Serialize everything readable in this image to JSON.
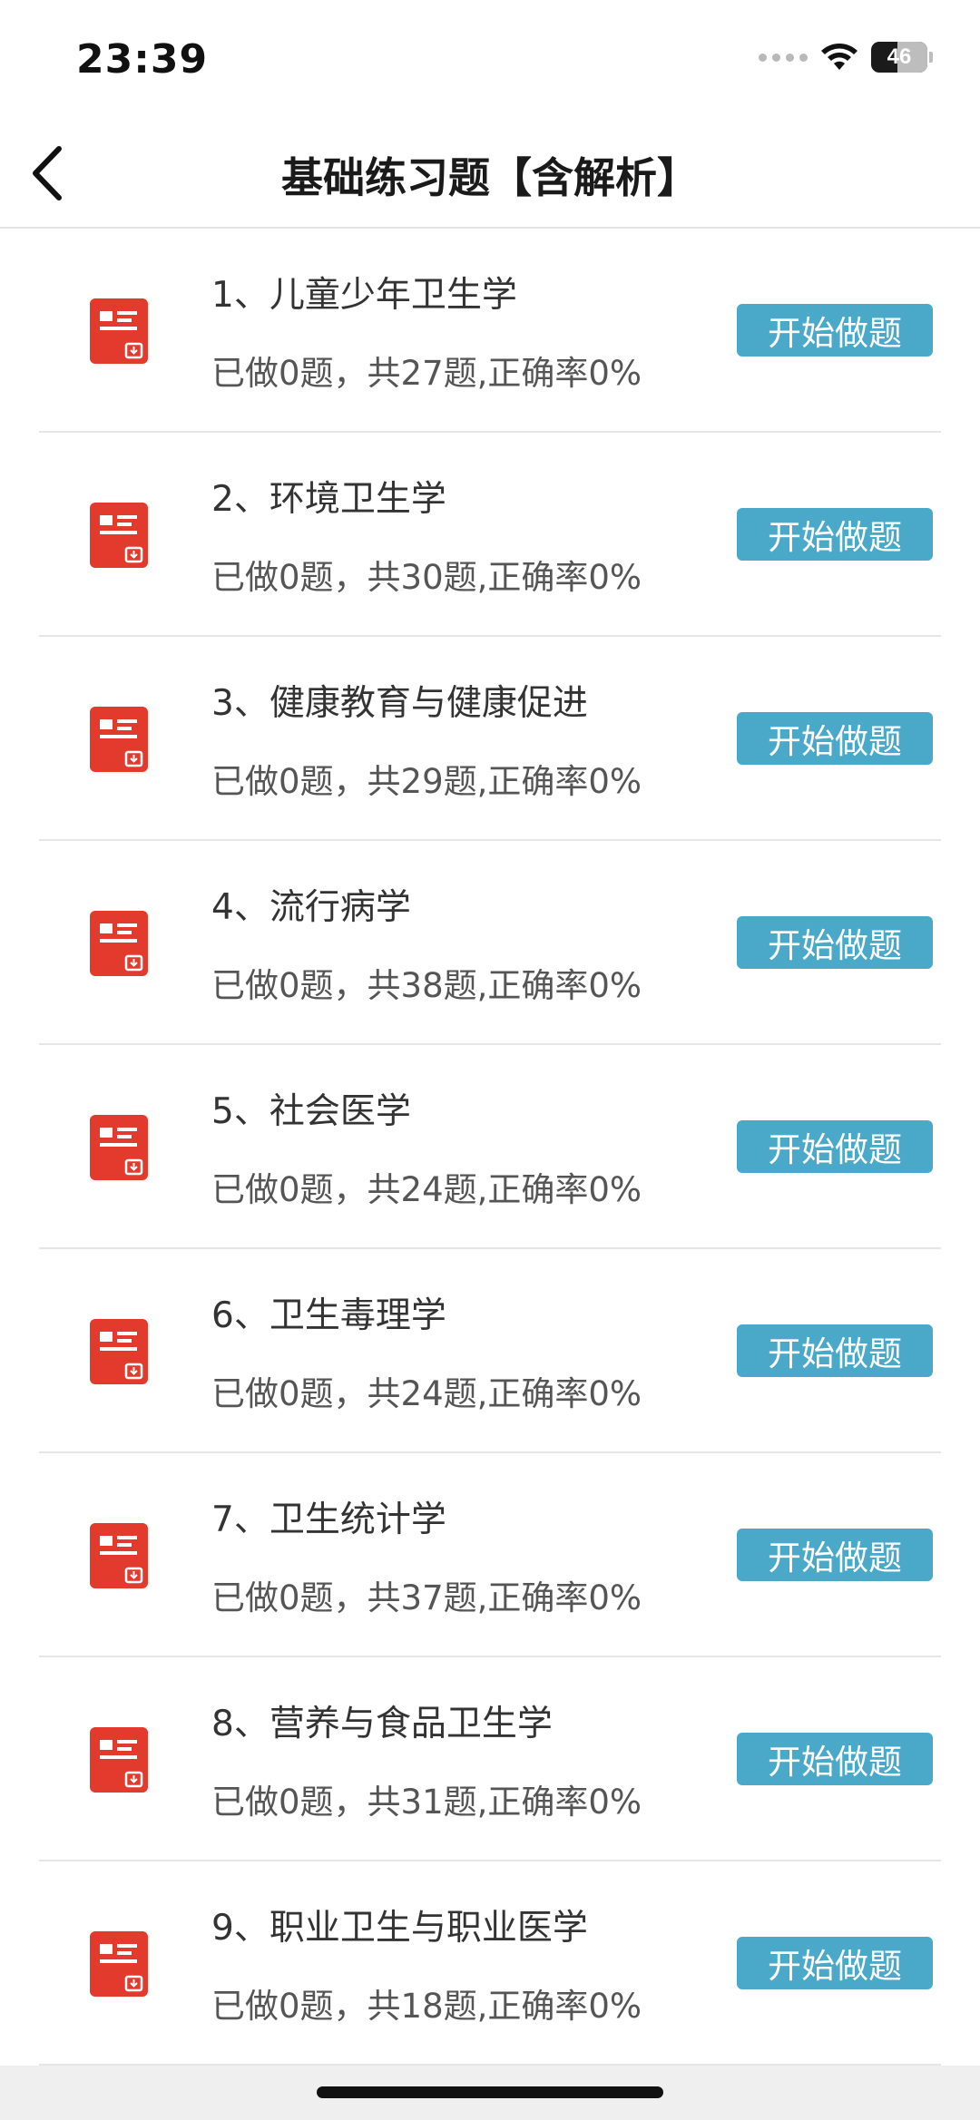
{
  "status_bar": {
    "time": "23:39",
    "battery_level": "46",
    "battery_fraction": 0.46,
    "icons": [
      "cellular-signal-icon",
      "wifi-icon",
      "battery-icon"
    ]
  },
  "nav": {
    "title": "基础练习题【含解析】",
    "back_icon": "chevron-left-icon"
  },
  "colors": {
    "accent_button": "#4aa8c9",
    "icon_red": "#e23b2e"
  },
  "items": [
    {
      "title": "1、儿童少年卫生学",
      "stats": "已做0题，共27题,正确率0%",
      "button": "开始做题",
      "icon": "document-icon"
    },
    {
      "title": "2、环境卫生学",
      "stats": "已做0题，共30题,正确率0%",
      "button": "开始做题",
      "icon": "document-icon"
    },
    {
      "title": "3、健康教育与健康促进",
      "stats": "已做0题，共29题,正确率0%",
      "button": "开始做题",
      "icon": "document-icon"
    },
    {
      "title": "4、流行病学",
      "stats": "已做0题，共38题,正确率0%",
      "button": "开始做题",
      "icon": "document-icon"
    },
    {
      "title": "5、社会医学",
      "stats": "已做0题，共24题,正确率0%",
      "button": "开始做题",
      "icon": "document-icon"
    },
    {
      "title": "6、卫生毒理学",
      "stats": "已做0题，共24题,正确率0%",
      "button": "开始做题",
      "icon": "document-icon"
    },
    {
      "title": "7、卫生统计学",
      "stats": "已做0题，共37题,正确率0%",
      "button": "开始做题",
      "icon": "document-icon"
    },
    {
      "title": "8、营养与食品卫生学",
      "stats": "已做0题，共31题,正确率0%",
      "button": "开始做题",
      "icon": "document-icon"
    },
    {
      "title": "9、职业卫生与职业医学",
      "stats": "已做0题，共18题,正确率0%",
      "button": "开始做题",
      "icon": "document-icon"
    }
  ]
}
